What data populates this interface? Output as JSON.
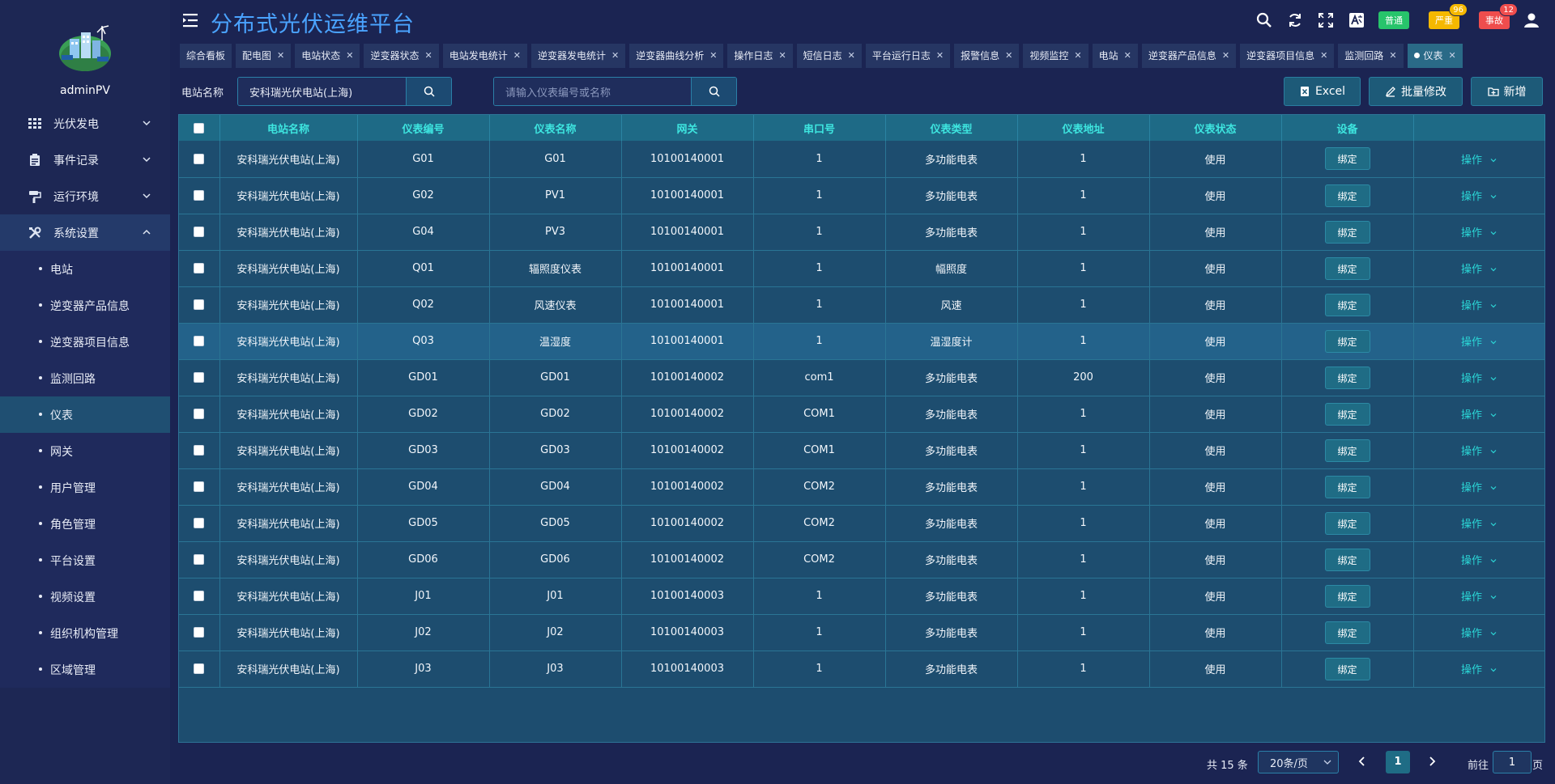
{
  "app": {
    "title": "分布式光伏运维平台",
    "user": "adminPV"
  },
  "header": {
    "badges": [
      {
        "label": "普通",
        "count": "",
        "color": "#27c46b"
      },
      {
        "label": "严重",
        "count": "96",
        "color": "#f5b800"
      },
      {
        "label": "事故",
        "count": "12",
        "color": "#ef4d4d"
      }
    ]
  },
  "sidebar": {
    "menus": [
      {
        "label": "光伏发电",
        "icon": "grid-icon"
      },
      {
        "label": "事件记录",
        "icon": "clipboard-icon"
      },
      {
        "label": "运行环境",
        "icon": "paint-roller-icon"
      },
      {
        "label": "系统设置",
        "icon": "tools-icon"
      }
    ],
    "submenu": [
      "电站",
      "逆变器产品信息",
      "逆变器项目信息",
      "监测回路",
      "仪表",
      "网关",
      "用户管理",
      "角色管理",
      "平台设置",
      "视频设置",
      "组织机构管理",
      "区域管理"
    ]
  },
  "tabs": [
    "综合看板",
    "配电图",
    "电站状态",
    "逆变器状态",
    "电站发电统计",
    "逆变器发电统计",
    "逆变器曲线分析",
    "操作日志",
    "短信日志",
    "平台运行日志",
    "报警信息",
    "视频监控",
    "电站",
    "逆变器产品信息",
    "逆变器项目信息",
    "监测回路",
    "仪表"
  ],
  "toolbar": {
    "station_label": "电站名称",
    "station_value": "安科瑞光伏电站(上海)",
    "search_placeholder": "请输入仪表编号或名称",
    "excel": "Excel",
    "batch": "批量修改",
    "add": "新增"
  },
  "table": {
    "headers": [
      "电站名称",
      "仪表编号",
      "仪表名称",
      "网关",
      "串口号",
      "仪表类型",
      "仪表地址",
      "仪表状态",
      "设备",
      ""
    ],
    "bind_label": "绑定",
    "op_label": "操作",
    "rows": [
      [
        "安科瑞光伏电站(上海)",
        "G01",
        "G01",
        "10100140001",
        "1",
        "多功能电表",
        "1",
        "使用"
      ],
      [
        "安科瑞光伏电站(上海)",
        "G02",
        "PV1",
        "10100140001",
        "1",
        "多功能电表",
        "1",
        "使用"
      ],
      [
        "安科瑞光伏电站(上海)",
        "G04",
        "PV3",
        "10100140001",
        "1",
        "多功能电表",
        "1",
        "使用"
      ],
      [
        "安科瑞光伏电站(上海)",
        "Q01",
        "辐照度仪表",
        "10100140001",
        "1",
        "幅照度",
        "1",
        "使用"
      ],
      [
        "安科瑞光伏电站(上海)",
        "Q02",
        "风速仪表",
        "10100140001",
        "1",
        "风速",
        "1",
        "使用"
      ],
      [
        "安科瑞光伏电站(上海)",
        "Q03",
        "温湿度",
        "10100140001",
        "1",
        "温湿度计",
        "1",
        "使用"
      ],
      [
        "安科瑞光伏电站(上海)",
        "GD01",
        "GD01",
        "10100140002",
        "com1",
        "多功能电表",
        "200",
        "使用"
      ],
      [
        "安科瑞光伏电站(上海)",
        "GD02",
        "GD02",
        "10100140002",
        "COM1",
        "多功能电表",
        "1",
        "使用"
      ],
      [
        "安科瑞光伏电站(上海)",
        "GD03",
        "GD03",
        "10100140002",
        "COM1",
        "多功能电表",
        "1",
        "使用"
      ],
      [
        "安科瑞光伏电站(上海)",
        "GD04",
        "GD04",
        "10100140002",
        "COM2",
        "多功能电表",
        "1",
        "使用"
      ],
      [
        "安科瑞光伏电站(上海)",
        "GD05",
        "GD05",
        "10100140002",
        "COM2",
        "多功能电表",
        "1",
        "使用"
      ],
      [
        "安科瑞光伏电站(上海)",
        "GD06",
        "GD06",
        "10100140002",
        "COM2",
        "多功能电表",
        "1",
        "使用"
      ],
      [
        "安科瑞光伏电站(上海)",
        "J01",
        "J01",
        "10100140003",
        "1",
        "多功能电表",
        "1",
        "使用"
      ],
      [
        "安科瑞光伏电站(上海)",
        "J02",
        "J02",
        "10100140003",
        "1",
        "多功能电表",
        "1",
        "使用"
      ],
      [
        "安科瑞光伏电站(上海)",
        "J03",
        "J03",
        "10100140003",
        "1",
        "多功能电表",
        "1",
        "使用"
      ]
    ]
  },
  "pager": {
    "total": "共 15 条",
    "size": "20条/页",
    "current": "1",
    "goto": "前往",
    "goto_value": "1",
    "page": "页"
  }
}
